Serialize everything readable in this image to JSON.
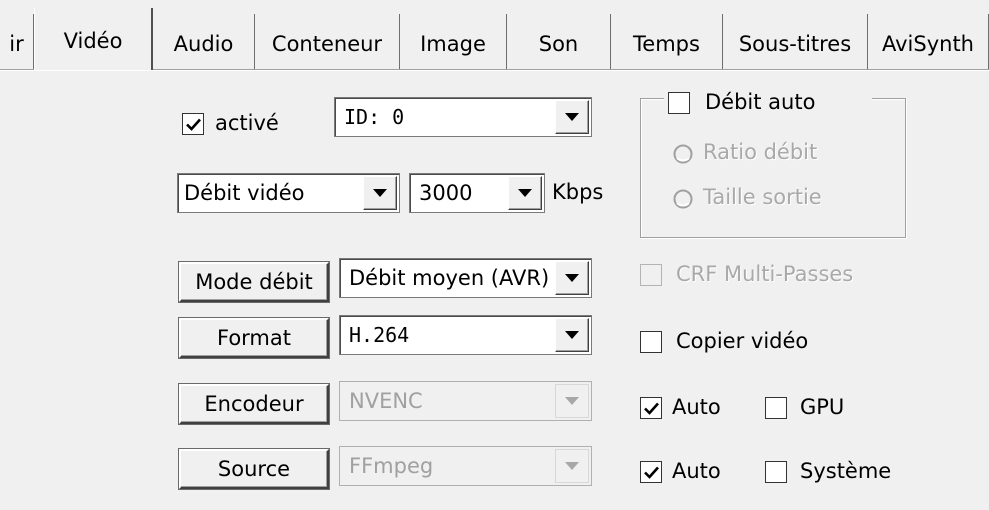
{
  "tabs": [
    {
      "label": "ir",
      "active": false
    },
    {
      "label": "Vidéo",
      "active": true
    },
    {
      "label": "Audio",
      "active": false
    },
    {
      "label": "Conteneur",
      "active": false
    },
    {
      "label": "Image",
      "active": false
    },
    {
      "label": "Son",
      "active": false
    },
    {
      "label": "Temps",
      "active": false
    },
    {
      "label": "Sous-titres",
      "active": false
    },
    {
      "label": "AviSynth",
      "active": false
    }
  ],
  "video": {
    "enabled": {
      "label": "activé",
      "checked": true
    },
    "stream_id": {
      "value": "ID: 0"
    },
    "bitrate_mode_select": {
      "value": "Débit vidéo"
    },
    "bitrate_value": {
      "value": "3000"
    },
    "bitrate_unit": "Kbps",
    "rate_mode": {
      "button": "Mode débit",
      "value": "Débit moyen (AVR)"
    },
    "format": {
      "button": "Format",
      "value": "H.264"
    },
    "encoder": {
      "button": "Encodeur",
      "value": "NVENC",
      "disabled": true
    },
    "source": {
      "button": "Source",
      "value": "FFmpeg",
      "disabled": true
    }
  },
  "auto_bitrate": {
    "label": "Débit auto",
    "checked": false,
    "options": [
      "Ratio débit",
      "Taille sortie"
    ]
  },
  "crf_multipass": {
    "label": "CRF Multi-Passes",
    "checked": false,
    "disabled": true
  },
  "copy_video": {
    "label": "Copier vidéo",
    "checked": false
  },
  "encoder_auto": {
    "label": "Auto",
    "checked": true
  },
  "gpu": {
    "label": "GPU",
    "checked": false
  },
  "source_auto": {
    "label": "Auto",
    "checked": true
  },
  "system": {
    "label": "Système",
    "checked": false
  },
  "colors": {
    "background": "#f0f0f0",
    "disabled_text": "#a9a9a9"
  }
}
